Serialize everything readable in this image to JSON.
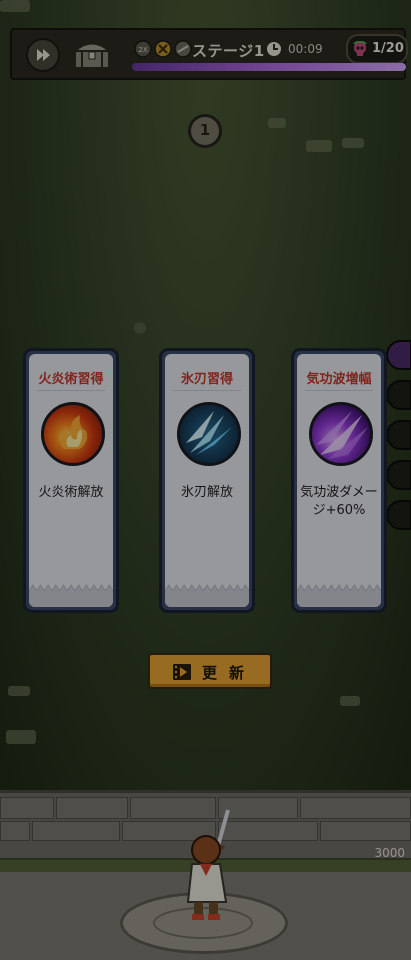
{
  "hud": {
    "stage_label": "ステージ1",
    "timer": "00:09",
    "kills": "1/20",
    "stage_progress_percent": 100,
    "speed_label": "2X"
  },
  "wave": {
    "number": "1"
  },
  "cards": [
    {
      "title": "火炎術習得",
      "description": "火炎術解放",
      "icon": "fire-icon"
    },
    {
      "title": "氷刃習得",
      "description": "氷刃解放",
      "icon": "ice-blade-icon"
    },
    {
      "title": "気功波増幅",
      "description": "気功波ダメージ+60%",
      "icon": "ki-wave-icon"
    }
  ],
  "refresh_button": {
    "label": "更新"
  },
  "player": {
    "hp": "3000"
  },
  "colors": {
    "card_title": "#c23a2b",
    "refresh_button": "#e8a534",
    "progress": "#b06be0"
  }
}
